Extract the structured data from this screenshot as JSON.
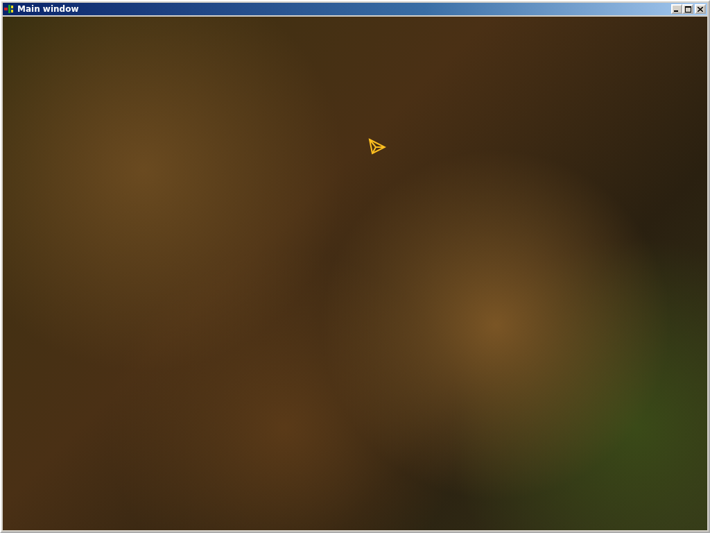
{
  "window": {
    "title": "Main window"
  }
}
